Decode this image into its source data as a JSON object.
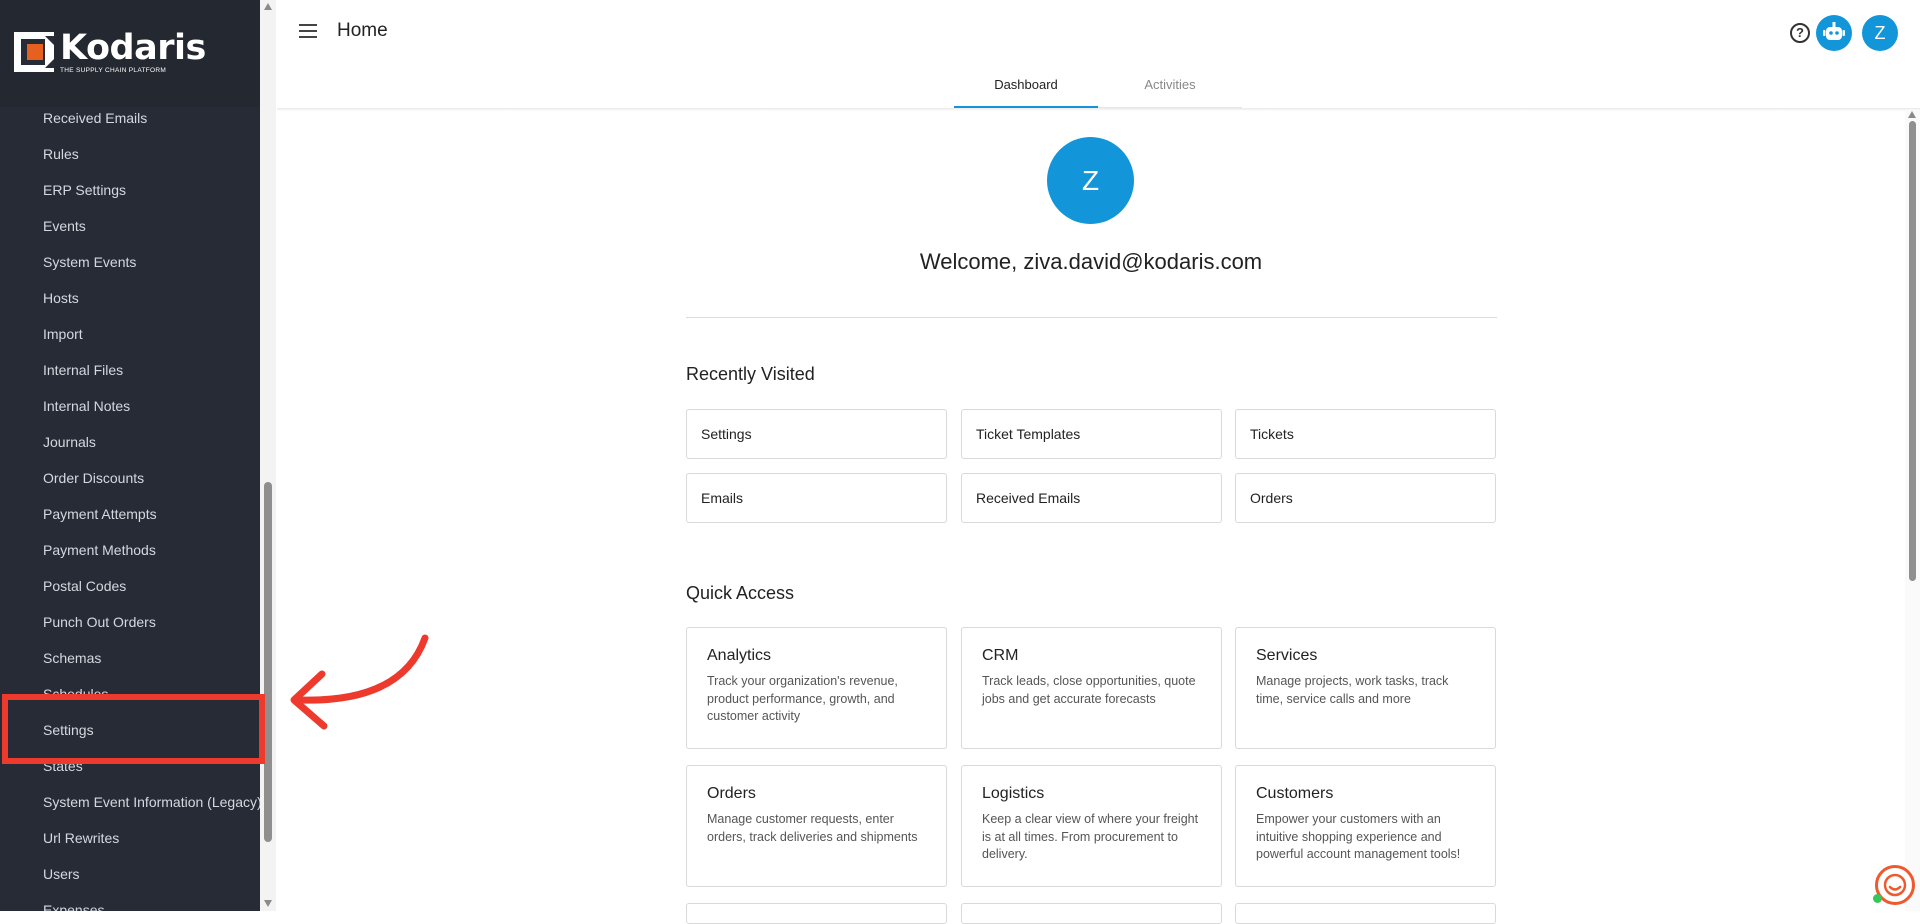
{
  "app": {
    "logo_text": "Kodaris",
    "logo_tagline": "THE SUPPLY CHAIN PLATFORM",
    "accent_color": "#1296d9",
    "highlight_color": "#ee3a2d"
  },
  "sidebar": {
    "items": [
      {
        "label": "Received Emails"
      },
      {
        "label": "Rules"
      },
      {
        "label": "ERP Settings"
      },
      {
        "label": "Events"
      },
      {
        "label": "System Events"
      },
      {
        "label": "Hosts"
      },
      {
        "label": "Import"
      },
      {
        "label": "Internal Files"
      },
      {
        "label": "Internal Notes"
      },
      {
        "label": "Journals"
      },
      {
        "label": "Order Discounts"
      },
      {
        "label": "Payment Attempts"
      },
      {
        "label": "Payment Methods"
      },
      {
        "label": "Postal Codes"
      },
      {
        "label": "Punch Out Orders"
      },
      {
        "label": "Schemas"
      },
      {
        "label": "Schedules"
      },
      {
        "label": "Settings"
      },
      {
        "label": "States"
      },
      {
        "label": "System Event Information (Legacy)"
      },
      {
        "label": "Url Rewrites"
      },
      {
        "label": "Users"
      },
      {
        "label": "Expenses"
      }
    ]
  },
  "header": {
    "menu_icon": "hamburger-icon",
    "title": "Home",
    "help_icon": "help-circle-icon",
    "bot_icon": "robot-icon",
    "avatar_initial": "Z"
  },
  "tabs": [
    {
      "label": "Dashboard",
      "active": true
    },
    {
      "label": "Activities",
      "active": false
    }
  ],
  "welcome": {
    "avatar_initial": "Z",
    "text": "Welcome, ziva.david@kodaris.com"
  },
  "recently_visited": {
    "title": "Recently Visited",
    "items": [
      "Settings",
      "Ticket Templates",
      "Tickets",
      "Emails",
      "Received Emails",
      "Orders"
    ]
  },
  "quick_access": {
    "title": "Quick Access",
    "items": [
      {
        "title": "Analytics",
        "desc": "Track your organization's revenue, product performance, growth, and customer activity"
      },
      {
        "title": "CRM",
        "desc": "Track leads, close opportunities, quote jobs and get accurate forecasts"
      },
      {
        "title": "Services",
        "desc": "Manage projects, work tasks, track time, service calls and more"
      },
      {
        "title": "Orders",
        "desc": "Manage customer requests, enter orders, track deliveries and shipments"
      },
      {
        "title": "Logistics",
        "desc": "Keep a clear view of where your freight is at all times. From procurement to delivery."
      },
      {
        "title": "Customers",
        "desc": "Empower your customers with an intuitive shopping experience and powerful account management tools!"
      }
    ]
  },
  "chat": {
    "icon": "chat-support-icon"
  }
}
